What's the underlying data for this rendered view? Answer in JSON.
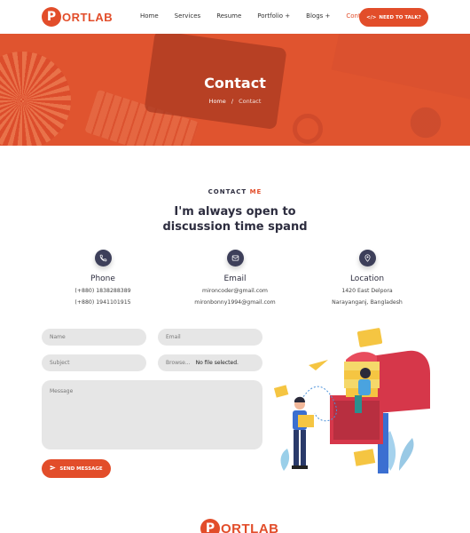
{
  "header": {
    "logo_letter": "P",
    "logo_text": "ORTLAB",
    "nav": [
      "Home",
      "Services",
      "Resume",
      "Portfolio +",
      "Blogs +",
      "Contact"
    ],
    "cta_label": "NEED TO TALK?",
    "cta_icon": "code-icon"
  },
  "hero": {
    "title": "Contact",
    "breadcrumb_home": "Home",
    "breadcrumb_sep": "/",
    "breadcrumb_current": "Contact"
  },
  "intro": {
    "kicker_a": "CONTACT",
    "kicker_b": "ME",
    "heading": "I'm always open to discussion time spand"
  },
  "info": [
    {
      "icon": "phone-icon",
      "title": "Phone",
      "lines": [
        "(+880) 1838288389",
        "(+880) 1941101915"
      ]
    },
    {
      "icon": "email-icon",
      "title": "Email",
      "lines": [
        "mironcoder@gmail.com",
        "mironbonny1994@gmail.com"
      ]
    },
    {
      "icon": "location-icon",
      "title": "Location",
      "lines": [
        "1420 East Delpora",
        "Narayanganj, Bangladesh"
      ]
    }
  ],
  "form": {
    "name_placeholder": "Name",
    "email_placeholder": "Email",
    "subject_placeholder": "Subject",
    "file_button": "Browse...",
    "file_status": "No file selected.",
    "message_placeholder": "Message",
    "send_label": "SEND MESSAGE"
  },
  "footer": {
    "logo_letter": "P",
    "logo_text": "ORTLAB"
  },
  "colors": {
    "accent": "#e24d2a",
    "dark": "#2d2d3f"
  }
}
